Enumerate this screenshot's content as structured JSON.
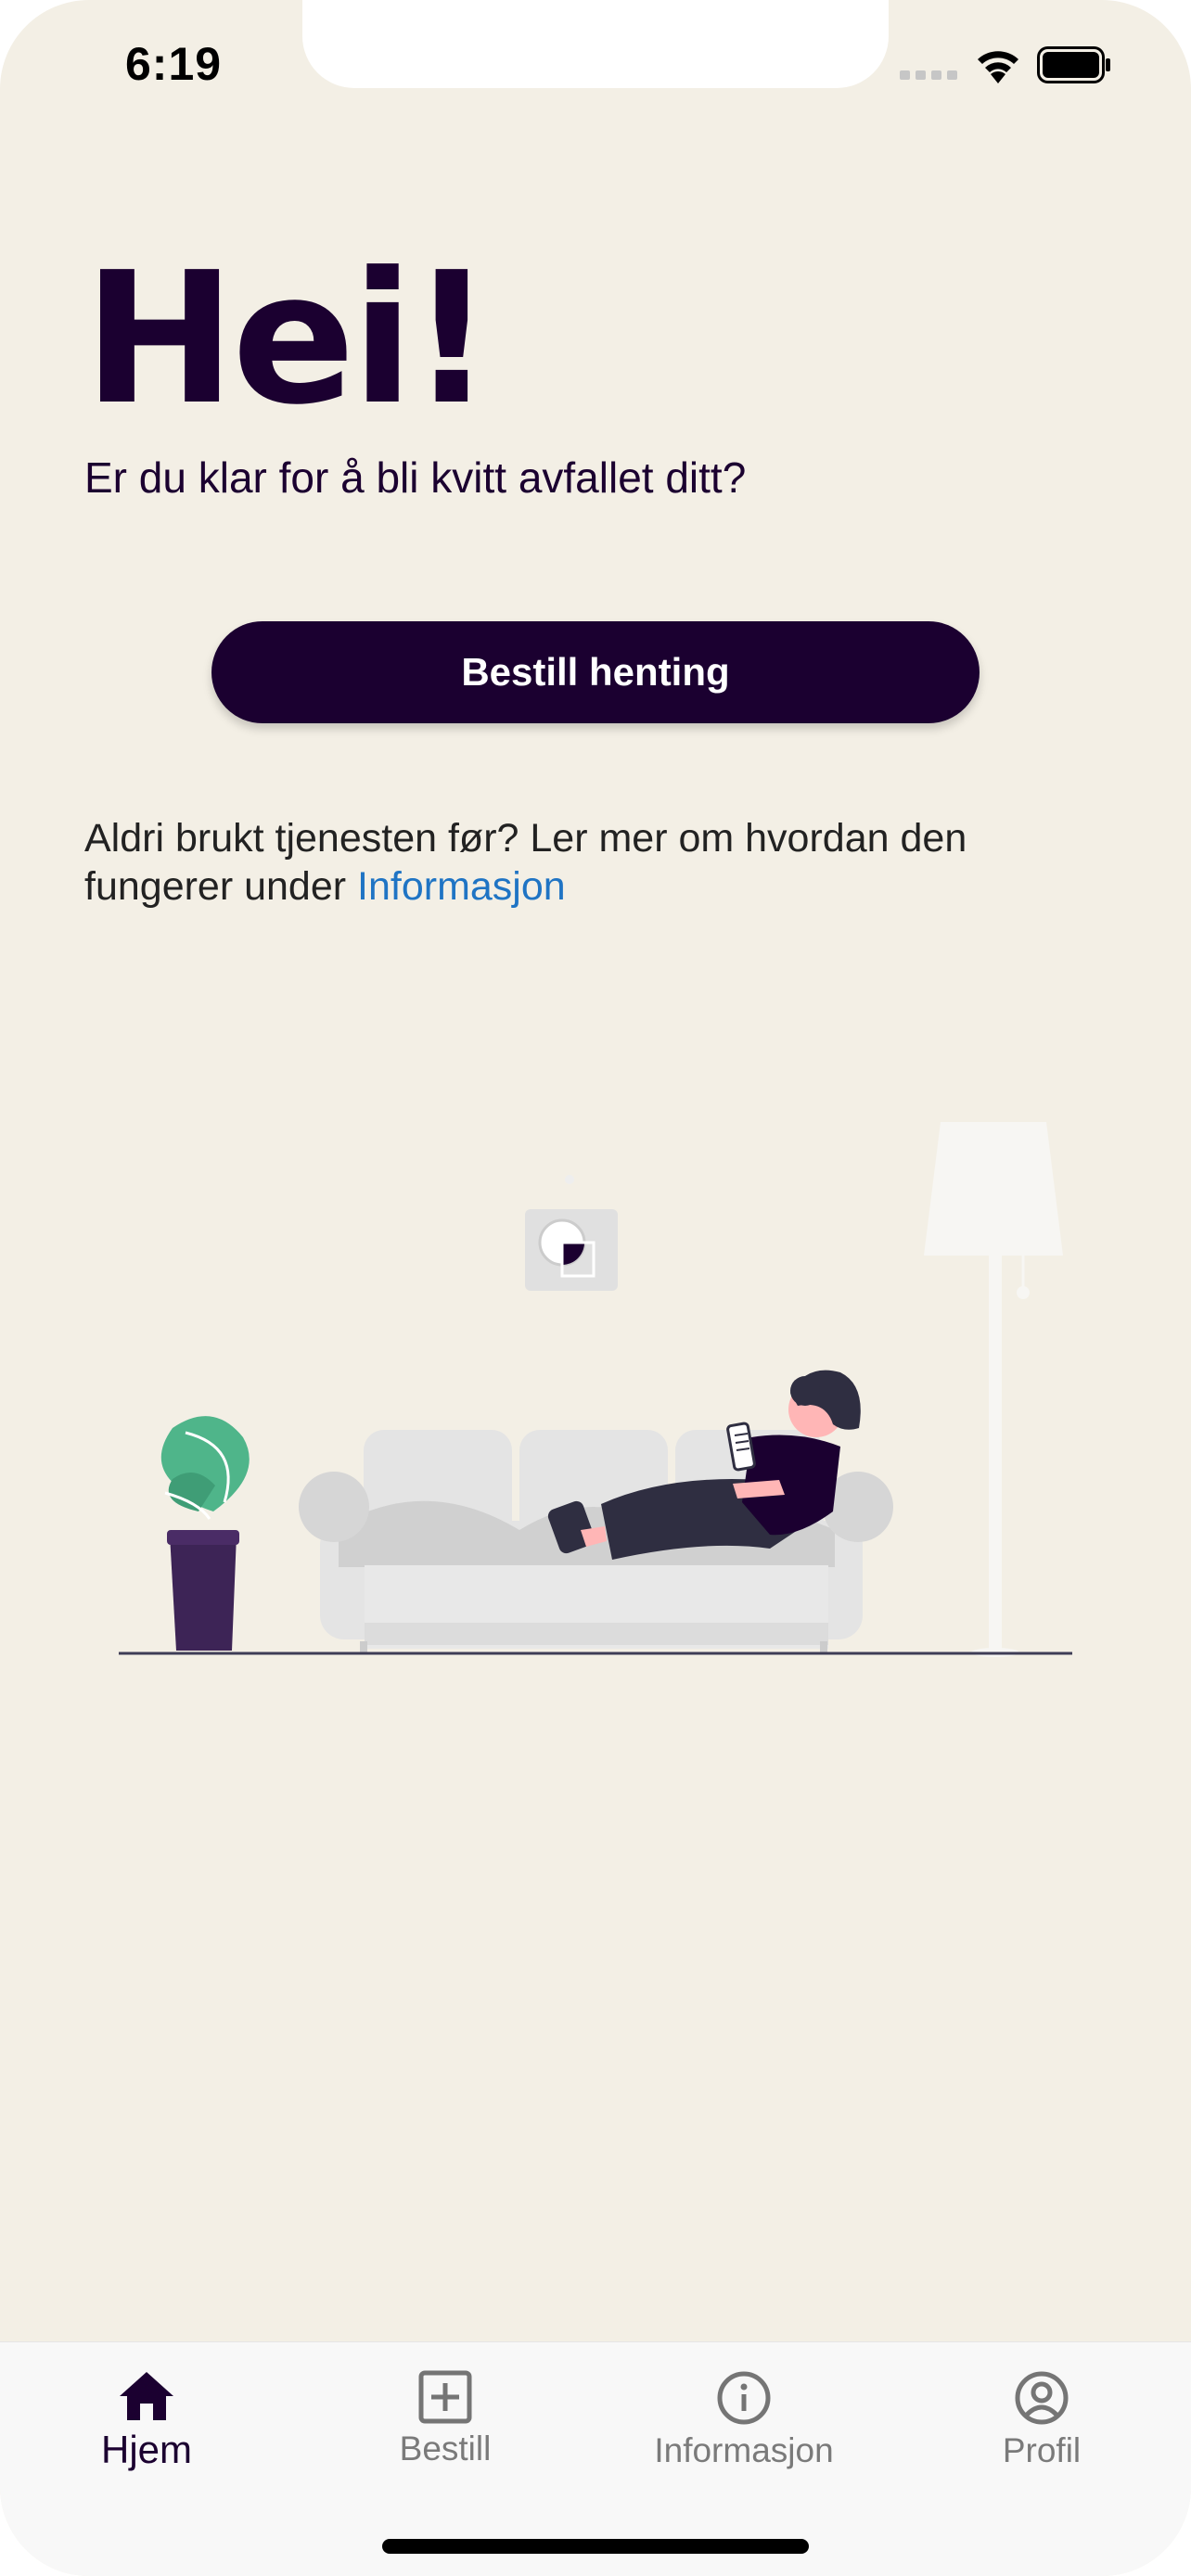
{
  "status_bar": {
    "time": "6:19",
    "icons": [
      "signal-icon",
      "wifi-icon",
      "battery-icon"
    ]
  },
  "hero": {
    "title": "Hei!",
    "subtitle": "Er du klar for å bli kvitt avfallet ditt?"
  },
  "cta": {
    "label": "Bestill henting"
  },
  "info": {
    "text_prefix": "Aldri brukt tjenesten før? Ler mer om hvordan den fungerer under ",
    "link_label": "Informasjon"
  },
  "tabbar": {
    "items": [
      {
        "label": "Hjem",
        "icon": "home-icon",
        "active": true
      },
      {
        "label": "Bestill",
        "icon": "plus-square-icon",
        "active": false
      },
      {
        "label": "Informasjon",
        "icon": "info-circle-icon",
        "active": false
      },
      {
        "label": "Profil",
        "icon": "profile-icon",
        "active": false
      }
    ]
  },
  "colors": {
    "background": "#f3efe5",
    "primary": "#1b0030",
    "link": "#1f74c4",
    "plant": "#4fb58a"
  }
}
